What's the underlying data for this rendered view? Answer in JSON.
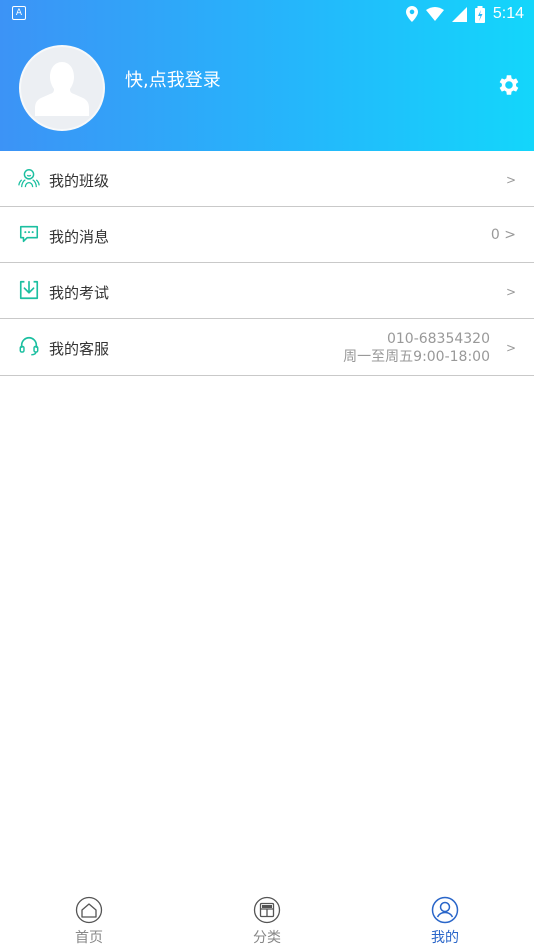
{
  "status_bar": {
    "time": "5:14",
    "notification_icon": "A"
  },
  "header": {
    "login_text": "快,点我登录"
  },
  "menu": {
    "items": [
      {
        "label": "我的班级",
        "value": "",
        "arrow": ">"
      },
      {
        "label": "我的消息",
        "value": "0 >",
        "arrow": ""
      },
      {
        "label": "我的考试",
        "value": "",
        "arrow": ">"
      },
      {
        "label": "我的客服",
        "phone": "010-68354320",
        "hours": "周一至周五9:00-18:00",
        "arrow": ">"
      }
    ]
  },
  "tabbar": {
    "tabs": [
      {
        "label": "首页",
        "active": false
      },
      {
        "label": "分类",
        "active": false
      },
      {
        "label": "我的",
        "active": true
      }
    ]
  },
  "colors": {
    "header_start": "#3c93f6",
    "header_end": "#13d6fb",
    "accent_teal": "#1bbfa0",
    "active_tab": "#2a66c9"
  }
}
